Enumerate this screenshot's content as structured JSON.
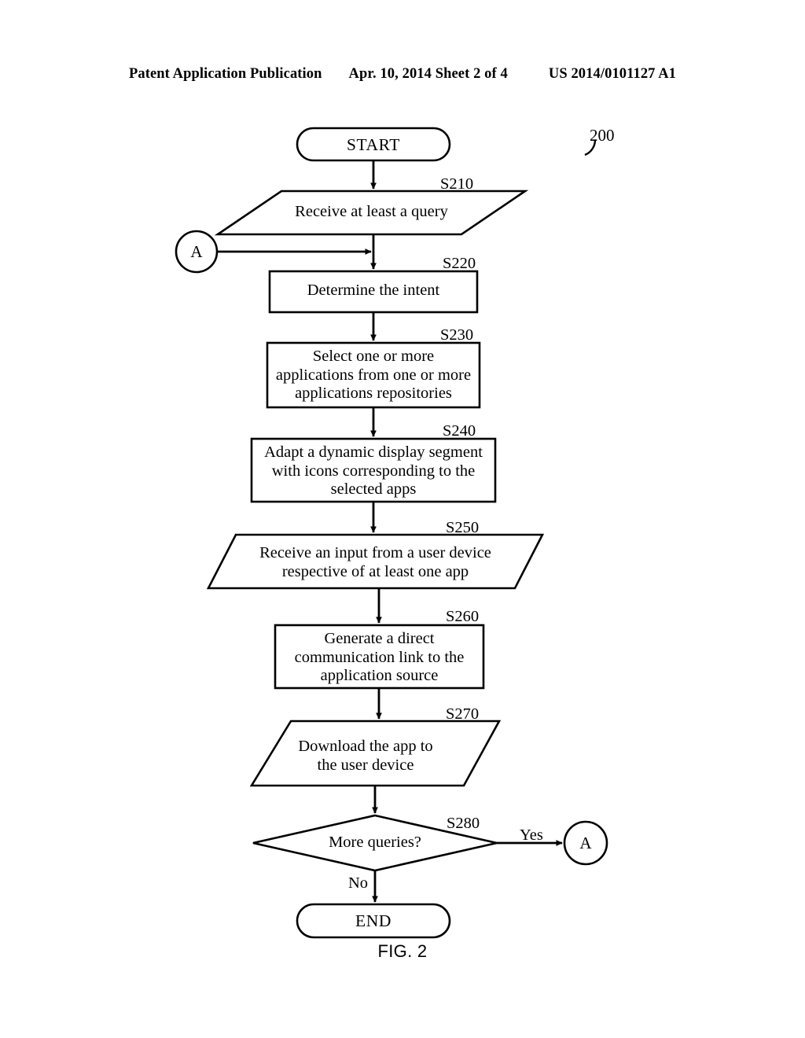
{
  "header": {
    "publication": "Patent Application Publication",
    "date_sheet": "Apr. 10, 2014  Sheet 2 of 4",
    "document_number": "US 2014/0101127 A1"
  },
  "figure": {
    "caption": "FIG. 2",
    "reference_numeral": "200"
  },
  "flowchart": {
    "start_label": "START",
    "end_label": "END",
    "connector_in_label": "A",
    "connector_out_label": "A",
    "nodes": [
      {
        "id": "S210",
        "step": "S210",
        "shape": "parallelogram",
        "text": "Receive at least a query"
      },
      {
        "id": "S220",
        "step": "S220",
        "shape": "rectangle",
        "text": "Determine the intent"
      },
      {
        "id": "S230",
        "step": "S230",
        "shape": "rectangle",
        "text": "Select one or more\napplications from one or more\napplications repositories"
      },
      {
        "id": "S240",
        "step": "S240",
        "shape": "rectangle",
        "text": "Adapt a dynamic display segment\nwith icons corresponding to the\nselected apps"
      },
      {
        "id": "S250",
        "step": "S250",
        "shape": "parallelogram",
        "text": "Receive an input from a user device\nrespective of at least one app"
      },
      {
        "id": "S260",
        "step": "S260",
        "shape": "rectangle",
        "text": "Generate a direct\ncommunication link to the\napplication source"
      },
      {
        "id": "S270",
        "step": "S270",
        "shape": "parallelogram",
        "text": "Download the app to\nthe user device"
      },
      {
        "id": "S280",
        "step": "S280",
        "shape": "diamond",
        "text": "More queries?"
      }
    ],
    "edge_labels": {
      "yes": "Yes",
      "no": "No"
    }
  },
  "colors": {
    "ink": "#000000",
    "paper": "#ffffff"
  }
}
